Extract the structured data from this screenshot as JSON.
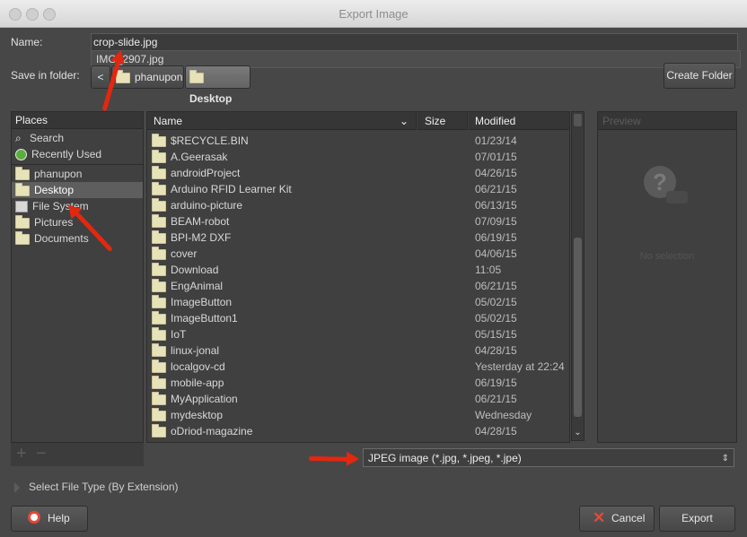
{
  "window": {
    "title": "Export Image"
  },
  "name_field": {
    "label": "Name:",
    "value": "crop-slide.jpg",
    "suggestion": "IMG_2907.jpg"
  },
  "folder": {
    "label": "Save in folder:",
    "back": "<",
    "crumbs": [
      "phanupon",
      "Desktop"
    ],
    "create_folder": "Create Folder"
  },
  "places": {
    "header": "Places",
    "items": [
      {
        "label": "Search",
        "icon": "search-icon"
      },
      {
        "label": "Recently Used",
        "icon": "recent-icon"
      },
      {
        "label": "phanupon",
        "icon": "folder-icon"
      },
      {
        "label": "Desktop",
        "icon": "folder-icon",
        "selected": true
      },
      {
        "label": "File System",
        "icon": "drive-icon"
      },
      {
        "label": "Pictures",
        "icon": "folder-icon"
      },
      {
        "label": "Documents",
        "icon": "folder-icon"
      }
    ],
    "add": "+",
    "remove": "−"
  },
  "files": {
    "columns": {
      "name": "Name",
      "size": "Size",
      "modified": "Modified"
    },
    "rows": [
      {
        "name": "$RECYCLE.BIN",
        "modified": "01/23/14"
      },
      {
        "name": "A.Geerasak",
        "modified": "07/01/15"
      },
      {
        "name": "androidProject",
        "modified": "04/26/15"
      },
      {
        "name": "Arduino RFID Learner Kit",
        "modified": "06/21/15"
      },
      {
        "name": "arduino-picture",
        "modified": "06/13/15"
      },
      {
        "name": "BEAM-robot",
        "modified": "07/09/15"
      },
      {
        "name": "BPI-M2 DXF",
        "modified": "06/19/15"
      },
      {
        "name": "cover",
        "modified": "04/06/15"
      },
      {
        "name": "Download",
        "modified": "11:05"
      },
      {
        "name": "EngAnimal",
        "modified": "06/21/15"
      },
      {
        "name": "ImageButton",
        "modified": "05/02/15"
      },
      {
        "name": "ImageButton1",
        "modified": "05/02/15"
      },
      {
        "name": "IoT",
        "modified": "05/15/15"
      },
      {
        "name": "linux-jonal",
        "modified": "04/28/15"
      },
      {
        "name": "localgov-cd",
        "modified": "Yesterday at 22:24"
      },
      {
        "name": "mobile-app",
        "modified": "06/19/15"
      },
      {
        "name": "MyApplication",
        "modified": "06/21/15"
      },
      {
        "name": "mydesktop",
        "modified": "Wednesday"
      },
      {
        "name": "oDriod-magazine",
        "modified": "04/28/15"
      }
    ]
  },
  "preview": {
    "header": "Preview",
    "empty": "No selection"
  },
  "file_type": {
    "selected": "JPEG image (*.jpg, *.jpeg, *.jpe)",
    "expander": "Select File Type (By Extension)"
  },
  "buttons": {
    "help": "Help",
    "cancel": "Cancel",
    "export": "Export"
  },
  "colors": {
    "accent_arrow": "#e4270f",
    "selection": "#5e5e5e"
  }
}
